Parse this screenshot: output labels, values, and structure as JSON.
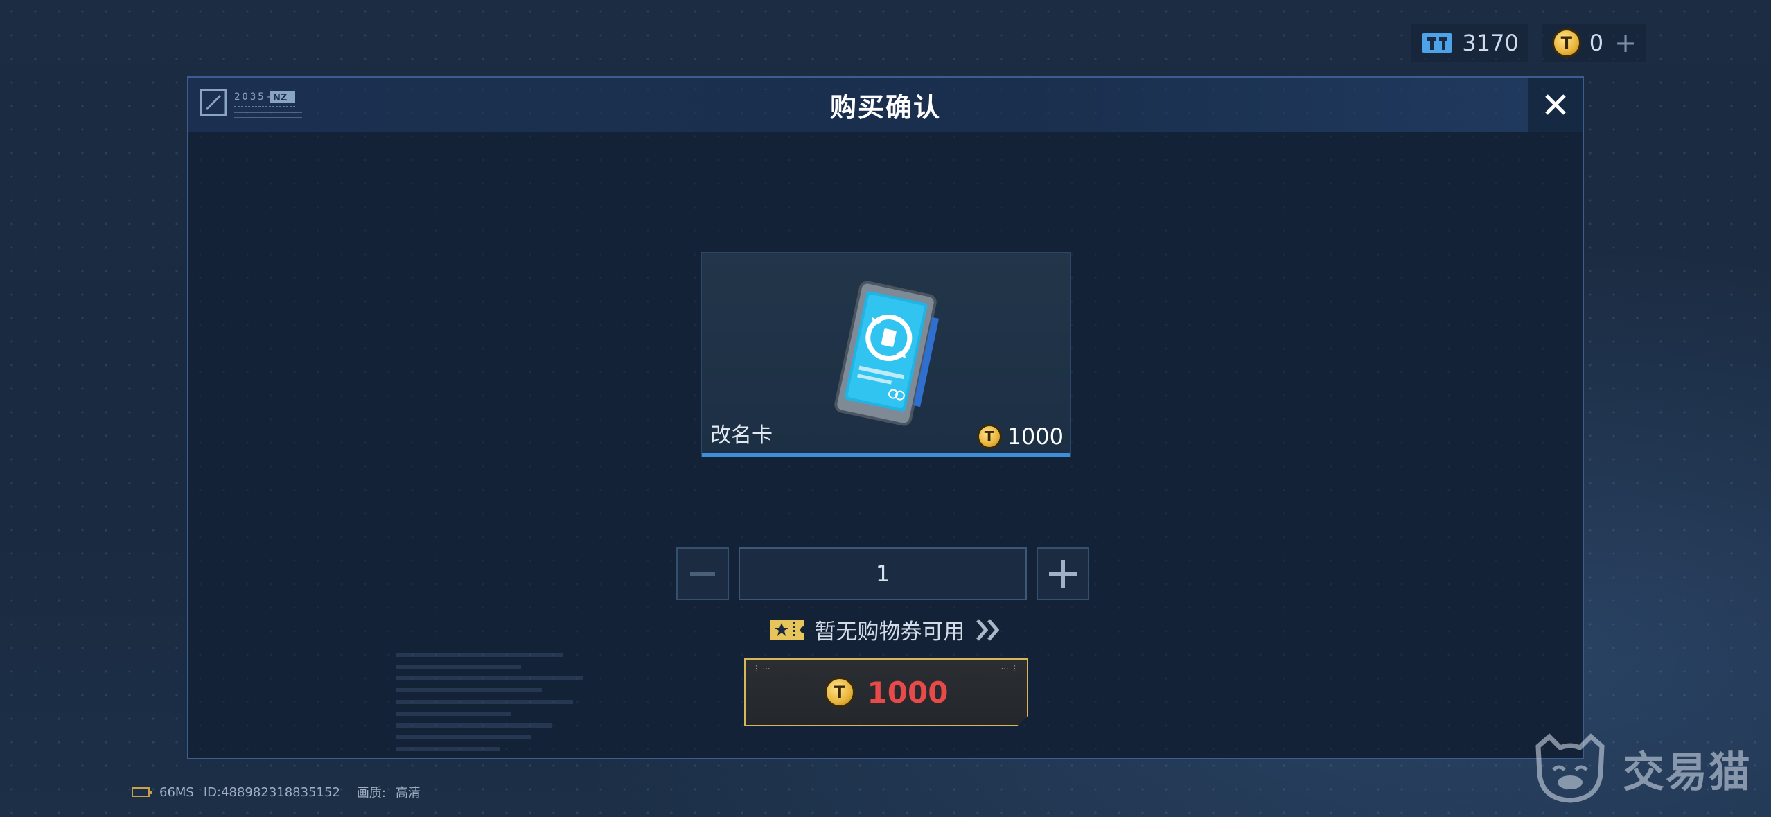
{
  "currency": {
    "ticket_value": "3170",
    "coin_value": "0",
    "coin_add_label": "+",
    "ticket_color": "#4ea3e8",
    "coin_color": "#e8b43b"
  },
  "modal": {
    "title": "购买确认",
    "header_logo_text": "2035-NZ"
  },
  "item": {
    "name": "改名卡",
    "price": "1000",
    "icon": "rename-card-icon"
  },
  "quantity": {
    "value": "1"
  },
  "coupon": {
    "text": "暂无购物券可用",
    "icon": "coupon-star-icon"
  },
  "buy": {
    "price": "1000",
    "price_color": "#e84a4a",
    "border_color": "#d8b65a"
  },
  "status": {
    "ping": "66MS",
    "id": "ID:488982318835152",
    "quality_label": "画质:",
    "quality_value": "高清"
  },
  "watermark": {
    "text": "交易猫"
  }
}
